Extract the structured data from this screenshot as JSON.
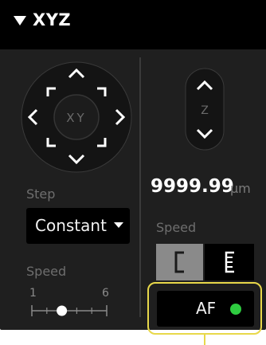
{
  "header": {
    "collapse_icon": "triangle-down-icon",
    "title": "XYZ"
  },
  "xy_pad": {
    "label": "XY",
    "icons": [
      "chevron-up-icon",
      "chevron-down-icon",
      "chevron-left-icon",
      "chevron-right-icon",
      "corner-arrow-icon"
    ]
  },
  "z_pad": {
    "label": "Z",
    "icons": [
      "chevron-up-icon",
      "chevron-down-icon"
    ]
  },
  "step": {
    "label": "Step",
    "selected": "Constant"
  },
  "left_speed": {
    "label": "Speed",
    "min_label": "1",
    "max_label": "6",
    "value": 3
  },
  "position": {
    "value": "9999.99",
    "unit": "μm"
  },
  "right_speed": {
    "label": "Speed",
    "options": [
      {
        "icon": "bracket-coarse-icon",
        "selected": true
      },
      {
        "icon": "bracket-fine-icon",
        "selected": false
      }
    ]
  },
  "af": {
    "label": "AF",
    "status_color": "#2ecc40"
  },
  "colors": {
    "highlight": "#e8d84a",
    "panel": "#1f1f1f",
    "header": "#000000"
  }
}
